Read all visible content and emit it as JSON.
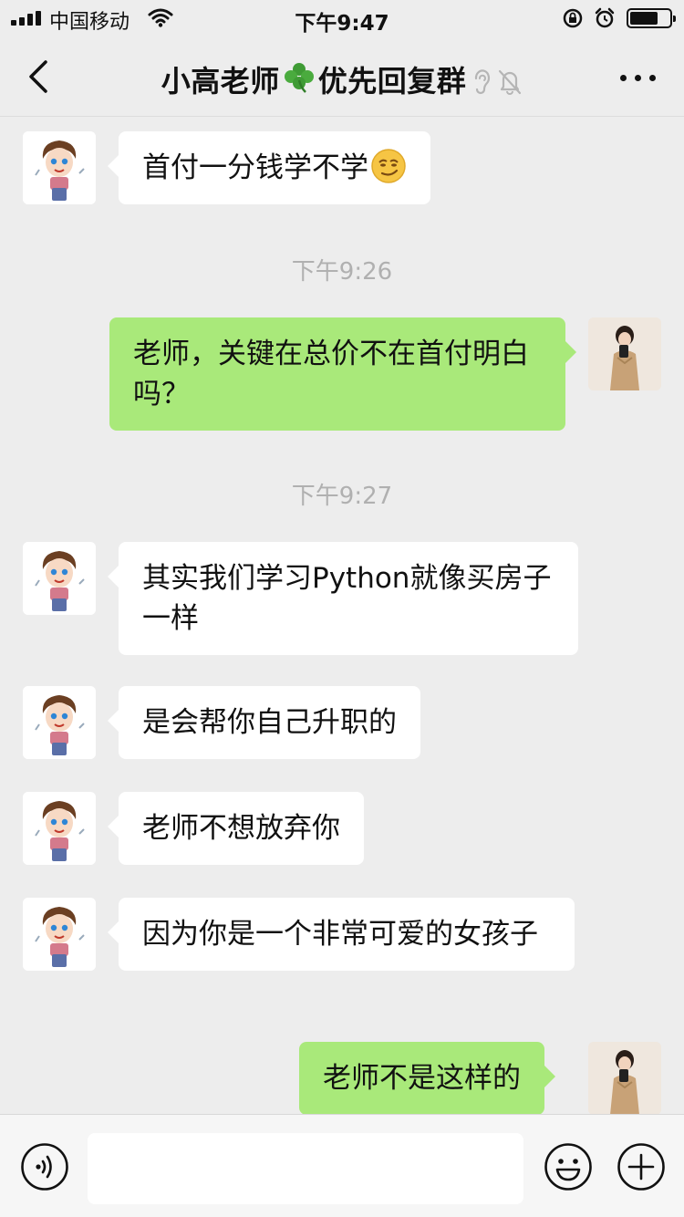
{
  "status_bar": {
    "carrier": "中国移动",
    "time": "下午9:47",
    "icons": [
      "signal-icon",
      "wifi-icon",
      "rotation-lock-icon",
      "alarm-icon",
      "battery-icon"
    ]
  },
  "nav": {
    "title_part1": "小高老师",
    "title_part2": "优先回复群",
    "icons": [
      "back-chevron-icon",
      "clover-icon",
      "ear-icon",
      "mute-bell-icon",
      "more-dots-icon"
    ]
  },
  "messages": [
    {
      "side": "left",
      "text": "首付一分钱学不学",
      "emoji": "smirk-face-emoji"
    },
    {
      "timestamp": "下午9:26"
    },
    {
      "side": "right",
      "text": "老师，关键在总价不在首付明白吗？"
    },
    {
      "timestamp": "下午9:27"
    },
    {
      "side": "left",
      "text": "其实我们学习Python就像买房子一样"
    },
    {
      "side": "left",
      "text": "是会帮你自己升职的"
    },
    {
      "side": "left",
      "text": "老师不想放弃你"
    },
    {
      "side": "left",
      "text": "因为你是一个非常可爱的女孩子"
    },
    {
      "side": "right",
      "text": "老师不是这样的"
    }
  ],
  "input_bar": {
    "value": "",
    "icons": [
      "voice-icon",
      "emoji-icon",
      "plus-icon"
    ]
  },
  "colors": {
    "background": "#ededed",
    "bubble_self": "#a9e97a",
    "bubble_other": "#ffffff",
    "timestamp": "#b0b0b0"
  }
}
